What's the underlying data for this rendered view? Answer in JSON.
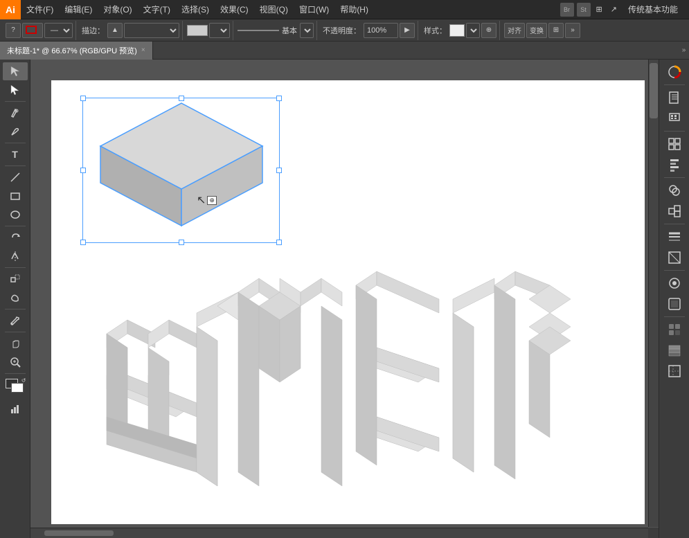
{
  "app": {
    "logo": "Ai",
    "logo_bg": "#FF7700"
  },
  "menu": {
    "items": [
      "文件(F)",
      "编辑(E)",
      "对象(O)",
      "文字(T)",
      "选择(S)",
      "效果(C)",
      "视图(Q)",
      "窗口(W)",
      "帮助(H)"
    ]
  },
  "right_menu": {
    "label": "传统基本功能",
    "bridge": "Br",
    "stock": "St"
  },
  "toolbar": {
    "question_btn": "?",
    "stroke_label": "描边：",
    "opacity_label": "不透明度：",
    "opacity_value": "100%",
    "style_label": "样式：",
    "align_label": "对齐",
    "transform_label": "变换"
  },
  "tab": {
    "title": "未标题-1* @ 66.67% (RGB/GPU 预览)",
    "close": "×"
  },
  "tools": {
    "left": [
      "▶",
      "⊕",
      "✏",
      "✒",
      "T",
      "□",
      "○",
      "◇",
      "⟲",
      "✂",
      "✋",
      "🔍",
      "⬛",
      "📊"
    ],
    "right": [
      "⬡",
      "▤",
      "⊞",
      "⊟",
      "◈",
      "≡",
      "□",
      "●",
      "⊙",
      "⊛",
      "⊞",
      "◈",
      "🔲"
    ]
  },
  "canvas": {
    "bg": "white",
    "zoom": "66.67%",
    "mode": "RGB/GPU 预览"
  },
  "colors": {
    "accent": "#4a9eff",
    "iso_top": "#d8d8d8",
    "iso_left": "#b0b0b0",
    "iso_right": "#c0c0c0",
    "iso_stroke": "#4a9eff"
  }
}
